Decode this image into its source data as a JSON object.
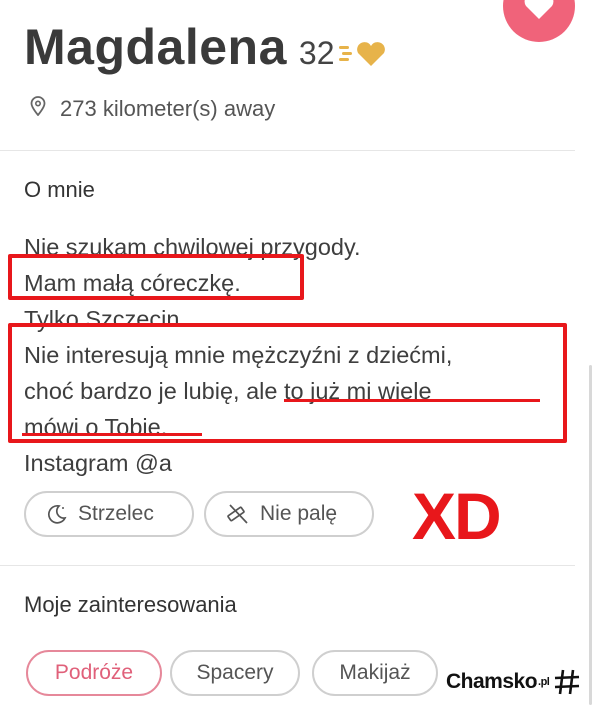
{
  "profile": {
    "name": "Magdalena",
    "age": "32",
    "distance": "273 kilometer(s) away"
  },
  "about": {
    "title": "O mnie",
    "lines": [
      "Nie szukam chwilowej przygody.",
      "Mam małą córeczkę.",
      "Tylko Szczecin.",
      "Nie interesują mnie mężczyźni z dziećmi,",
      "choć bardzo je lubię, ale to już mi wiele",
      "mówi o Tobie.",
      "Instagram @a"
    ]
  },
  "tags": [
    {
      "label": "Strzelec",
      "icon": "moon-icon"
    },
    {
      "label": "Nie palę",
      "icon": "no-smoking-icon"
    }
  ],
  "annotation": {
    "text": "XD",
    "color": "#e8171b"
  },
  "interests": {
    "title": "Moje zainteresowania",
    "items": [
      "Podróże",
      "Spacery",
      "Makijaż"
    ]
  },
  "watermark": {
    "brand": "Chamsko",
    "suffix": ".pl"
  },
  "colors": {
    "accent": "#f0637a",
    "highlight": "#e8171b",
    "gold": "#e7b34a"
  }
}
